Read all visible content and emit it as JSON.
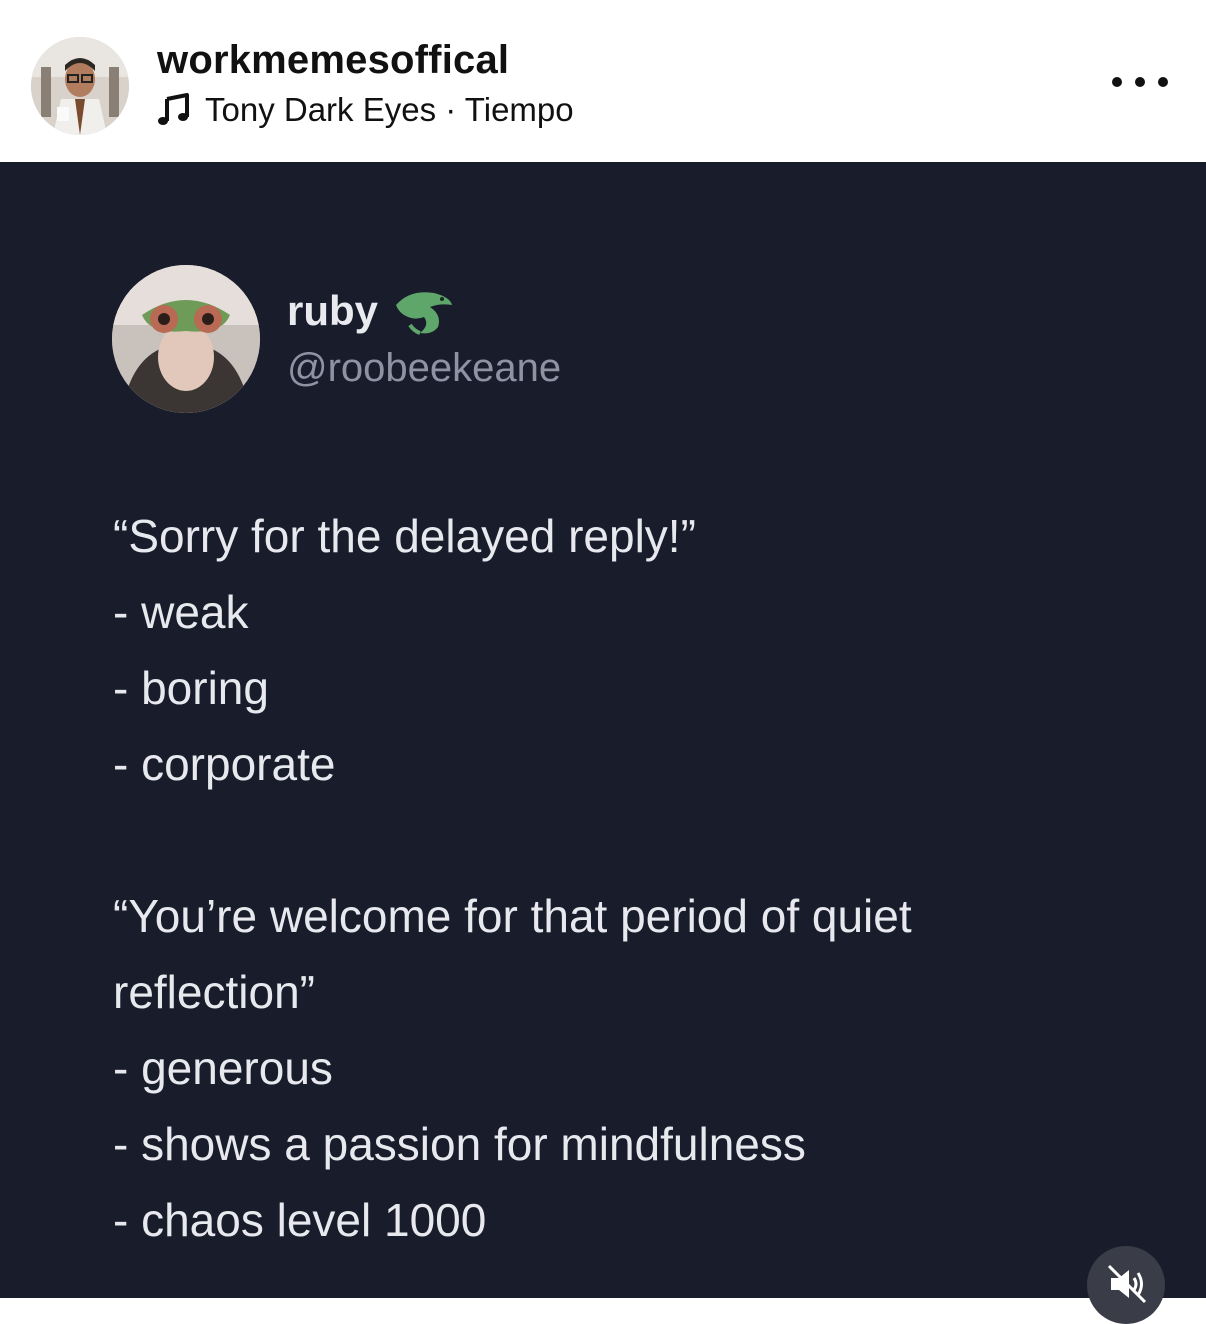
{
  "post": {
    "username": "workmemesoffical",
    "music": "Tony Dark Eyes · Tiempo",
    "icons": {
      "music": "music-note-icon",
      "more": "more-options-icon",
      "mute": "muted-speaker-icon"
    }
  },
  "tweet": {
    "name": "ruby",
    "emoji_icon": "crocodile-icon",
    "handle": "@roobeekeane",
    "lines": [
      "“Sorry for the delayed reply!”",
      "- weak",
      "- boring",
      "- corporate",
      "“You’re welcome for that period of quiet",
      "reflection”",
      "- generous",
      "- shows a passion for mindfulness",
      "- chaos level 1000"
    ]
  },
  "colors": {
    "media_background": "#191d2b",
    "tweet_text": "#e8e9ee",
    "handle_text": "#8d93a3"
  }
}
